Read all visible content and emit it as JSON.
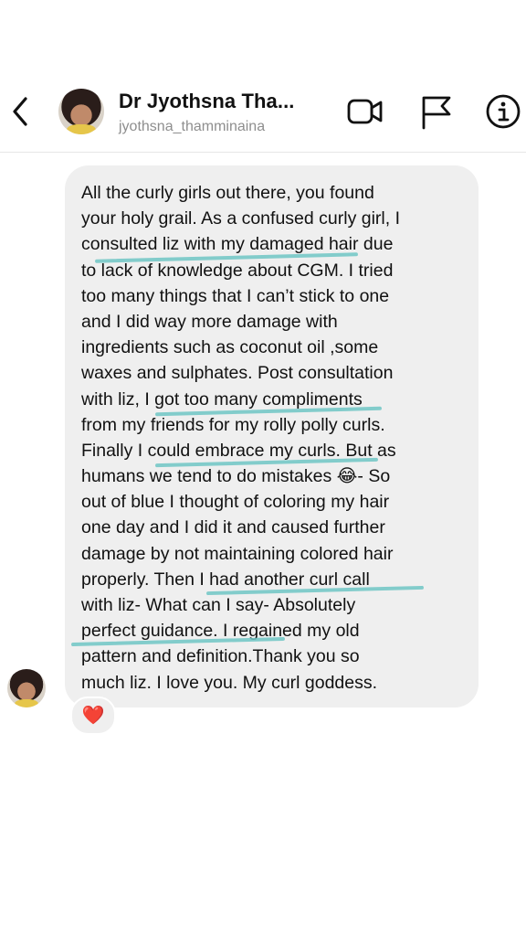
{
  "header": {
    "back_icon": "chevron-left-icon",
    "contact_name": "Dr Jyothsna Tha...",
    "contact_handle": "jyothsna_thamminaina",
    "actions": [
      "video-call-icon",
      "flag-icon",
      "info-icon"
    ]
  },
  "message": {
    "lines": [
      "All the curly girls out there, you found",
      "your holy grail. As a confused curly girl, I",
      "consulted liz with my damaged hair due",
      "to lack of knowledge about CGM. I tried",
      "too many things that I can’t stick to one",
      "and I did way more damage with",
      "ingredients such as coconut oil ,some",
      "waxes and sulphates. Post consultation",
      "with liz, I got too many compliments",
      "from my friends for my rolly polly curls.",
      "Finally I could embrace my curls. But as",
      "humans we tend to do mistakes 😂- So",
      "out of blue I thought of coloring my hair",
      "one day and I did it and caused further",
      "damage by not maintaining colored hair",
      "properly. Then I had another curl call",
      "with liz- What can I say- Absolutely",
      "perfect guidance. I regained my old",
      "pattern and definition.Thank you so",
      "much liz. I love you. My curl goddess."
    ],
    "highlight_color": "#6fc6c4",
    "reaction": "❤️"
  },
  "colors": {
    "bubble": "#efefef",
    "handle": "#8e8e8e"
  }
}
